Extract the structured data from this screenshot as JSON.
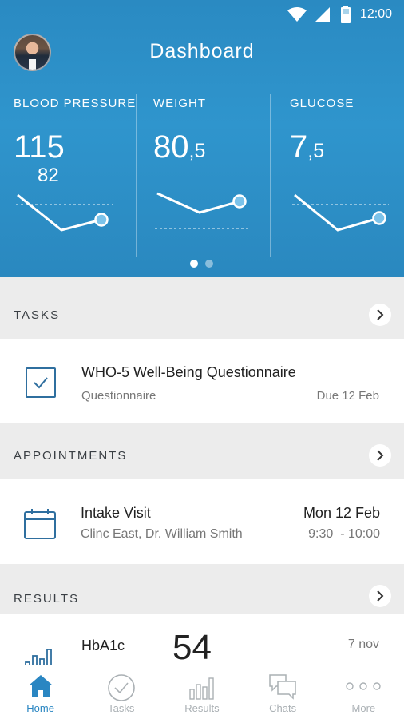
{
  "status_bar": {
    "time": "12:00"
  },
  "header": {
    "title": "Dashboard"
  },
  "vitals": [
    {
      "label": "BLOOD PRESSURE",
      "value_int": "115",
      "value_dec": "",
      "sub_value": "82",
      "trend": "down-then-up"
    },
    {
      "label": "WEIGHT",
      "value_int": "80",
      "value_dec": ",5",
      "sub_value": "",
      "trend": "down-then-up"
    },
    {
      "label": "GLUCOSE",
      "value_int": "7",
      "value_dec": ",5",
      "sub_value": "",
      "trend": "down-then-up"
    }
  ],
  "pager": {
    "page_count": 2,
    "active_page": 1
  },
  "tasks": {
    "title": "TASKS",
    "items": [
      {
        "title": "WHO-5 Well-Being Questionnaire",
        "type": "Questionnaire",
        "due": "Due 12 Feb",
        "icon": "checkbox-icon"
      }
    ]
  },
  "appointments": {
    "title": "APPOINTMENTS",
    "items": [
      {
        "title": "Intake Visit",
        "location": "Clinc East, Dr. William Smith",
        "date": "Mon 12 Feb",
        "time": "9:30  - 10:00",
        "icon": "calendar-icon"
      }
    ]
  },
  "results": {
    "title": "RESULTS",
    "items": [
      {
        "name": "HbA1c",
        "value": "54",
        "date": "7 nov",
        "icon": "bar-chart-icon"
      }
    ]
  },
  "bottom_nav": [
    {
      "label": "Home",
      "icon": "home-icon",
      "active": true
    },
    {
      "label": "Tasks",
      "icon": "check-circle-icon",
      "active": false
    },
    {
      "label": "Results",
      "icon": "bar-chart-icon",
      "active": false
    },
    {
      "label": "Chats",
      "icon": "chat-bubbles-icon",
      "active": false
    },
    {
      "label": "More",
      "icon": "more-dots-icon",
      "active": false
    }
  ],
  "colors": {
    "header_blue": "#2f95cd",
    "accent": "#2a86c2",
    "icon_dark_blue": "#2f6f9f",
    "background": "#ececec"
  }
}
